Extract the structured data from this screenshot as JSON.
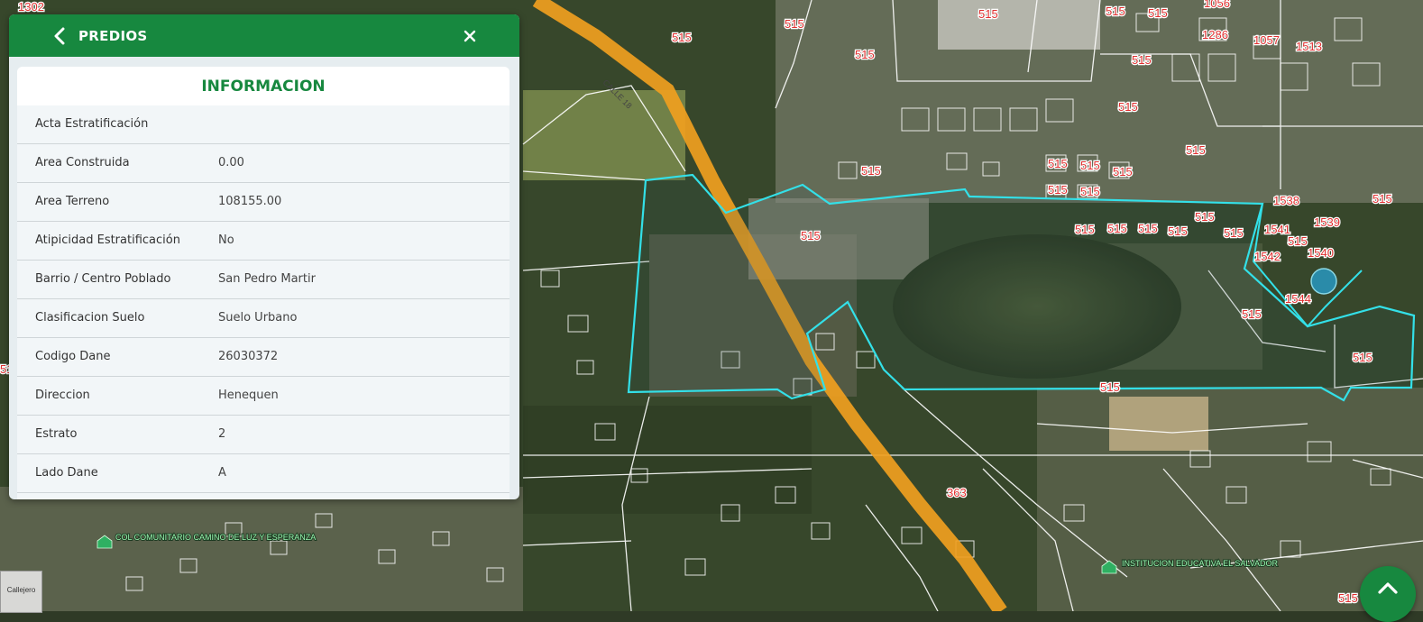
{
  "panel": {
    "title": "PREDIOS",
    "card_title": "INFORMACION",
    "rows": [
      {
        "label": "Acta  Estratificación",
        "value": ""
      },
      {
        "label": "Area Construida",
        "value": "0.00"
      },
      {
        "label": "Area Terreno",
        "value": "108155.00"
      },
      {
        "label": "Atipicidad Estratificación",
        "value": "No"
      },
      {
        "label": "Barrio / Centro Poblado",
        "value": "San Pedro Martir"
      },
      {
        "label": "Clasificacion  Suelo",
        "value": "Suelo Urbano"
      },
      {
        "label": "Codigo Dane",
        "value": "26030372"
      },
      {
        "label": "Direccion",
        "value": "Henequen"
      },
      {
        "label": "Estrato",
        "value": "2"
      },
      {
        "label": "Lado Dane",
        "value": "A"
      }
    ]
  },
  "map": {
    "road_label": "CALLE 18",
    "lot_labels": [
      "1302",
      "515",
      "515",
      "515",
      "515",
      "515",
      "515",
      "1056",
      "1286",
      "1057",
      "1513",
      "515",
      "515",
      "515",
      "515",
      "515",
      "515",
      "515",
      "515",
      "515",
      "515",
      "515",
      "515",
      "515",
      "515",
      "515",
      "515",
      "1538",
      "1539",
      "1541",
      "515",
      "1540",
      "1542",
      "1544",
      "515",
      "515",
      "515",
      "515",
      "363",
      "515",
      "515"
    ],
    "poi": [
      {
        "name": "COL COMUNITARIO CAMINO DE LUZ Y ESPERANZA"
      },
      {
        "name": "INSTITUCION EDUCATIVA EL SALVADOR"
      }
    ],
    "highlight_color": "#33e0e8",
    "road_color": "#f0a020"
  },
  "basemap": {
    "label": "Callejero"
  },
  "colors": {
    "brand": "#17883f",
    "panel_bg": "#e6edf0"
  }
}
